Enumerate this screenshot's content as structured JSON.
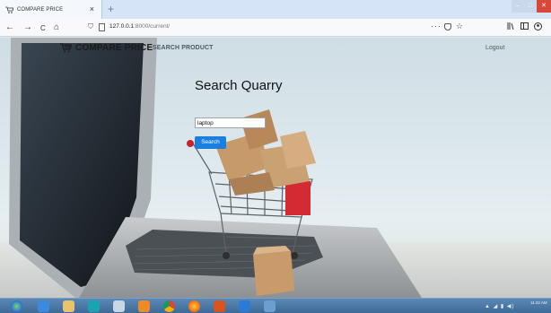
{
  "browser": {
    "tab_title": "COMPARE PRICE",
    "tab_close": "×",
    "new_tab": "+",
    "url_host": "127.0.0.1",
    "url_rest": ":8000/current/",
    "url_more": "···",
    "url_star": "☆",
    "nav_back": "←",
    "nav_forward": "→",
    "nav_reload": "C",
    "nav_home": "⌂",
    "library_icon": "library-icon",
    "sidebar_icon": "sidebar-icon",
    "account_icon": "account-icon"
  },
  "site": {
    "brand": "COMPARE PRICE",
    "nav_search": "SEARCH PRODUCT",
    "logout": "Logout"
  },
  "main": {
    "heading": "Search Quarry",
    "search_value": "laptop",
    "search_button": "Search"
  },
  "colors": {
    "accent": "#1a7fe0",
    "taskbar": "#3d6a98",
    "close": "#d8483a"
  },
  "taskbar": {
    "clock_time": "11:42 AM",
    "icons": [
      "start-orb-icon",
      "ie-icon",
      "folder-icon",
      "arduino-icon",
      "paint-icon",
      "media-icon",
      "chrome-icon",
      "firefox-icon",
      "matlab-icon",
      "vscode-icon",
      "python-icon"
    ]
  }
}
